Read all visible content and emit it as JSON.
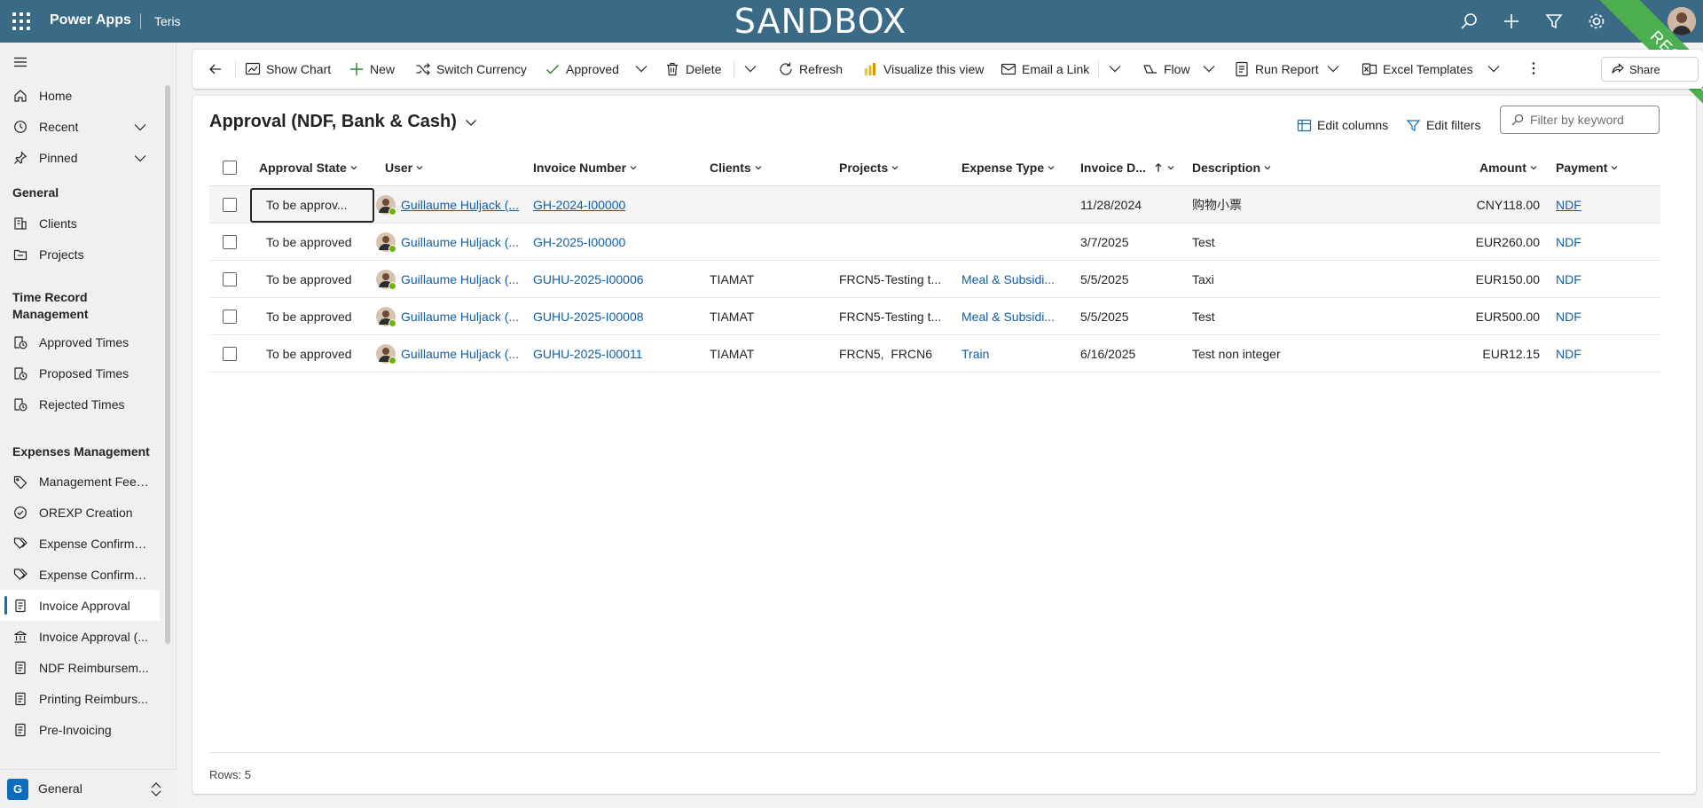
{
  "topbar": {
    "brand": "Power Apps",
    "env": "Teris",
    "banner": "SANDBOX",
    "ribbon": "RECETTE",
    "icons": [
      "search-icon",
      "plus-icon",
      "filter-icon",
      "gear-icon",
      "help-icon",
      "avatar"
    ]
  },
  "sidebar": {
    "top_items": [
      {
        "label": "Home",
        "icon": "home-icon"
      },
      {
        "label": "Recent",
        "icon": "clock-icon"
      },
      {
        "label": "Pinned",
        "icon": "pin-icon"
      }
    ],
    "sections": [
      {
        "title": "General",
        "items": [
          {
            "label": "Clients"
          },
          {
            "label": "Projects"
          }
        ]
      },
      {
        "title": "Time Record Management",
        "items": [
          {
            "label": "Approved Times"
          },
          {
            "label": "Proposed Times"
          },
          {
            "label": "Rejected Times"
          }
        ]
      },
      {
        "title": "Expenses Management",
        "items": [
          {
            "label": "Management Fee ..."
          },
          {
            "label": "OREXP Creation"
          },
          {
            "label": "Expense Confirma..."
          },
          {
            "label": "Expense Confirma..."
          },
          {
            "label": "Invoice Approval"
          },
          {
            "label": "Invoice Approval (..."
          },
          {
            "label": "NDF Reimbursem..."
          },
          {
            "label": "Printing Reimburs..."
          },
          {
            "label": "Pre-Invoicing"
          }
        ]
      }
    ],
    "area": {
      "letter": "G",
      "label": "General"
    }
  },
  "commandbar": {
    "show_chart": "Show Chart",
    "new": "New",
    "switch_currency": "Switch Currency",
    "approved": "Approved",
    "delete": "Delete",
    "refresh": "Refresh",
    "visualize": "Visualize this view",
    "email_link": "Email a Link",
    "flow": "Flow",
    "run_report": "Run Report",
    "excel_templates": "Excel Templates",
    "share": "Share"
  },
  "view": {
    "title": "Approval (NDF, Bank & Cash)",
    "edit_columns": "Edit columns",
    "edit_filters": "Edit filters",
    "filter_placeholder": "Filter by keyword"
  },
  "grid": {
    "columns": {
      "approval_state": "Approval State",
      "user": "User",
      "invoice_number": "Invoice Number",
      "clients": "Clients",
      "projects": "Projects",
      "expense_type": "Expense Type",
      "invoice_date": "Invoice D...",
      "description": "Description",
      "amount": "Amount",
      "payment": "Payment"
    },
    "rows": [
      {
        "state": "To be approv...",
        "user": "Guillaume Huljack (...",
        "invoice": "GH-2024-I00000",
        "client": "",
        "project": "",
        "expense_type": "",
        "date": "11/28/2024",
        "description": "购物小票",
        "amount": "CNY118.00",
        "payment": "NDF"
      },
      {
        "state": "To be approved",
        "user": "Guillaume Huljack (...",
        "invoice": "GH-2025-I00000",
        "client": "",
        "project": "",
        "expense_type": "",
        "date": "3/7/2025",
        "description": "Test",
        "amount": "EUR260.00",
        "payment": "NDF"
      },
      {
        "state": "To be approved",
        "user": "Guillaume Huljack (...",
        "invoice": "GUHU-2025-I00006",
        "client": "TIAMAT",
        "project": "FRCN5-Testing t...",
        "expense_type": "Meal & Subsidi...",
        "date": "5/5/2025",
        "description": "Taxi",
        "amount": "EUR150.00",
        "payment": "NDF"
      },
      {
        "state": "To be approved",
        "user": "Guillaume Huljack (...",
        "invoice": "GUHU-2025-I00008",
        "client": "TIAMAT",
        "project": "FRCN5-Testing t...",
        "expense_type": "Meal & Subsidi...",
        "date": "5/5/2025",
        "description": "Test",
        "amount": "EUR500.00",
        "payment": "NDF"
      },
      {
        "state": "To be approved",
        "user": "Guillaume Huljack (...",
        "invoice": "GUHU-2025-I00011",
        "client": "TIAMAT",
        "project": "FRCN5,  FRCN6",
        "expense_type": "Train",
        "date": "6/16/2025",
        "description": "Test non integer",
        "amount": "EUR12.15",
        "payment": "NDF"
      }
    ],
    "footer": "Rows: 5"
  },
  "colors": {
    "topbar": "#3a6a85",
    "accent": "#0f6cbd",
    "link": "#115ea3",
    "ribbon": "#4caf50",
    "presence": "#6bb700"
  }
}
